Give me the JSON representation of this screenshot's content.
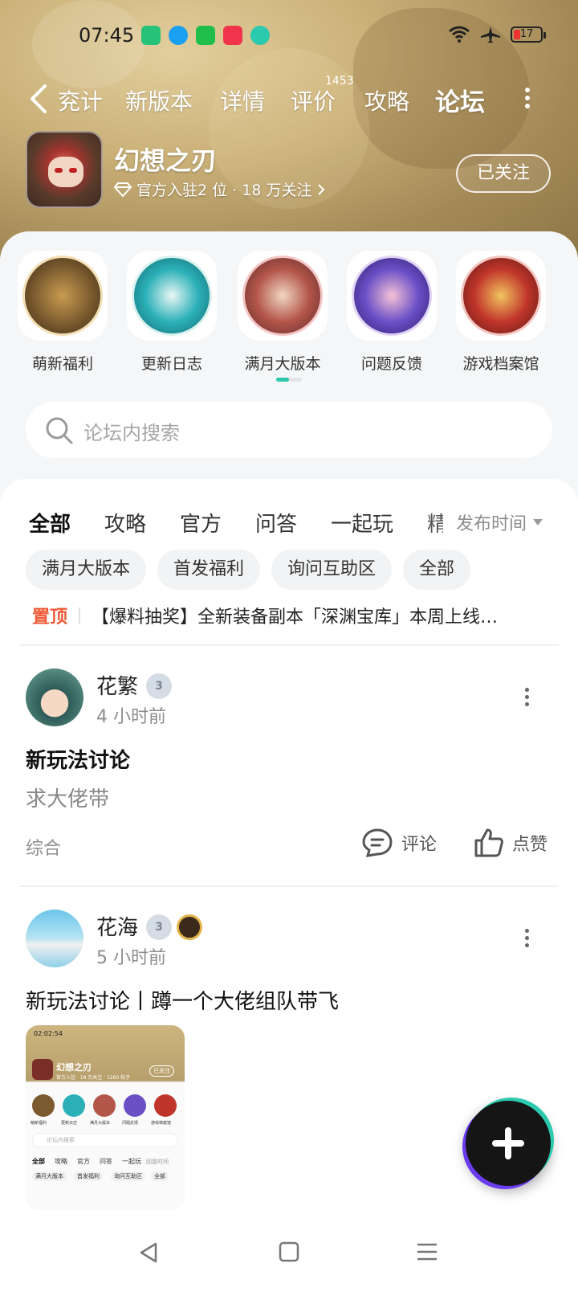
{
  "status_bar": {
    "time": "07:45",
    "battery": "17"
  },
  "nav": {
    "back_label": "兖计",
    "tabs": [
      {
        "label": "新版本"
      },
      {
        "label": "详情"
      },
      {
        "label": "评价",
        "badge": "1453"
      },
      {
        "label": "攻略"
      },
      {
        "label": "论坛",
        "active": true
      }
    ]
  },
  "game": {
    "title": "幻想之刃",
    "meta": "官方入驻2 位 · 18 万关注",
    "follow_label": "已关注"
  },
  "sections": [
    {
      "label": "萌新福利",
      "color": "#7a5a2e"
    },
    {
      "label": "更新日志",
      "color": "#2bb0b8"
    },
    {
      "label": "满月大版本",
      "color": "#d26b6b"
    },
    {
      "label": "问题反馈",
      "color": "#6a4fc7"
    },
    {
      "label": "游戏档案馆",
      "color": "#c0352b"
    }
  ],
  "search": {
    "placeholder": "论坛内搜索"
  },
  "content_tabs": [
    {
      "label": "全部",
      "active": true
    },
    {
      "label": "攻略"
    },
    {
      "label": "官方"
    },
    {
      "label": "问答"
    },
    {
      "label": "一起玩"
    },
    {
      "label": "精"
    }
  ],
  "sort_label": "发布时间",
  "chips": [
    "满月大版本",
    "首发福利",
    "询问互助区",
    "全部"
  ],
  "pinned": {
    "tag": "置顶",
    "text": "【爆料抽奖】全新装备副本「深渊宝库」本周上线…"
  },
  "posts": [
    {
      "user": "花繁",
      "level": "3",
      "time": "4 小时前",
      "title": "新玩法讨论",
      "body": "求大佬带",
      "category": "综合",
      "comment_label": "评论",
      "like_label": "点赞"
    },
    {
      "user": "花海",
      "level": "3",
      "time": "5 小时前",
      "title": "新玩法讨论丨蹲一个大佬组队带飞"
    }
  ],
  "thumb": {
    "time": "02:02:54",
    "title": "幻想之刃",
    "meta": "官方入驻 · 18 万关注 · 1260 帖子",
    "follow": "已关注",
    "sections": [
      "萌新福利",
      "更新日志",
      "满月大版本",
      "问题反馈",
      "游戏档案馆"
    ],
    "search": "论坛内搜索",
    "tabs": [
      "全部",
      "攻略",
      "官方",
      "问答",
      "一起玩",
      "回复时间"
    ],
    "chips": [
      "满月大版本",
      "首发福利",
      "询问互助区",
      "全部"
    ]
  },
  "colors": {
    "accent": "#2bd6b6",
    "pinned": "#f05a36"
  }
}
